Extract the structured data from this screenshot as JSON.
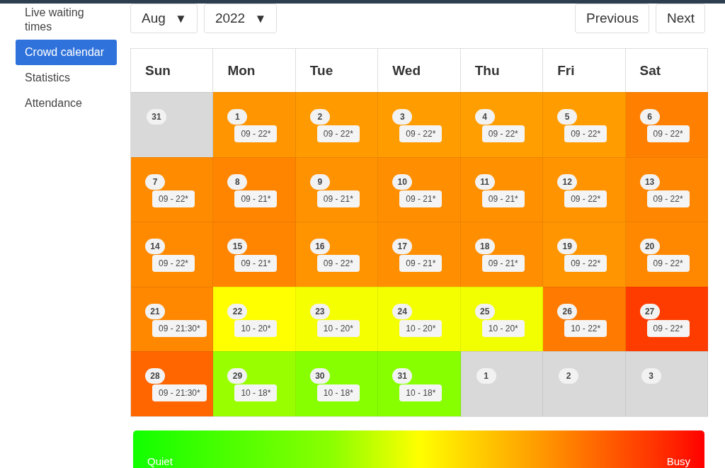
{
  "sidebar": {
    "items": [
      {
        "label": "Live waiting times",
        "selected": false
      },
      {
        "label": "Crowd calendar",
        "selected": true
      },
      {
        "label": "Statistics",
        "selected": false
      },
      {
        "label": "Attendance",
        "selected": false
      }
    ]
  },
  "controls": {
    "month": {
      "value": "Aug",
      "caret": "▼"
    },
    "year": {
      "value": "2022",
      "caret": "▼"
    },
    "buttons": [
      "Previous",
      "Next"
    ]
  },
  "calendar": {
    "weekdays": [
      "Sun",
      "Mon",
      "Tue",
      "Wed",
      "Thu",
      "Fri",
      "Sat"
    ],
    "weeks": [
      [
        {
          "day": "31",
          "kind": "other",
          "color": "#d9d9d9"
        },
        {
          "day": "1",
          "hours": "09 - 22*",
          "kind": "month",
          "color": "#ff9500"
        },
        {
          "day": "2",
          "hours": "09 - 22*",
          "kind": "month",
          "color": "#ff9a00"
        },
        {
          "day": "3",
          "hours": "09 - 22*",
          "kind": "month",
          "color": "#ff9c00"
        },
        {
          "day": "4",
          "hours": "09 - 22*",
          "kind": "month",
          "color": "#ff9e00"
        },
        {
          "day": "5",
          "hours": "09 - 22*",
          "kind": "month",
          "color": "#ff9d00"
        },
        {
          "day": "6",
          "hours": "09 - 22*",
          "kind": "month",
          "color": "#ff8000"
        }
      ],
      [
        {
          "day": "7",
          "hours": "09 - 22*",
          "kind": "month",
          "color": "#ff8c00"
        },
        {
          "day": "8",
          "hours": "09 - 21*",
          "kind": "month",
          "color": "#ff8500"
        },
        {
          "day": "9",
          "hours": "09 - 21*",
          "kind": "month",
          "color": "#ff9200"
        },
        {
          "day": "10",
          "hours": "09 - 21*",
          "kind": "month",
          "color": "#ff8e00"
        },
        {
          "day": "11",
          "hours": "09 - 21*",
          "kind": "month",
          "color": "#ff9000"
        },
        {
          "day": "12",
          "hours": "09 - 22*",
          "kind": "month",
          "color": "#ff9400"
        },
        {
          "day": "13",
          "hours": "09 - 22*",
          "kind": "month",
          "color": "#ff8600"
        }
      ],
      [
        {
          "day": "14",
          "hours": "09 - 22*",
          "kind": "month",
          "color": "#ff8a00"
        },
        {
          "day": "15",
          "hours": "09 - 21*",
          "kind": "month",
          "color": "#ff8400"
        },
        {
          "day": "16",
          "hours": "09 - 22*",
          "kind": "month",
          "color": "#ff9300"
        },
        {
          "day": "17",
          "hours": "09 - 21*",
          "kind": "month",
          "color": "#ff8f00"
        },
        {
          "day": "18",
          "hours": "09 - 21*",
          "kind": "month",
          "color": "#ff8e00"
        },
        {
          "day": "19",
          "hours": "09 - 22*",
          "kind": "month",
          "color": "#ff9500"
        },
        {
          "day": "20",
          "hours": "09 - 22*",
          "kind": "month",
          "color": "#ff8800"
        }
      ],
      [
        {
          "day": "21",
          "hours": "09 - 21:30*",
          "kind": "month",
          "color": "#ff8800"
        },
        {
          "day": "22",
          "hours": "10 - 20*",
          "kind": "month",
          "color": "#ffff00"
        },
        {
          "day": "23",
          "hours": "10 - 20*",
          "kind": "month",
          "color": "#f5ff00"
        },
        {
          "day": "24",
          "hours": "10 - 20*",
          "kind": "month",
          "color": "#f4ff00"
        },
        {
          "day": "25",
          "hours": "10 - 20*",
          "kind": "month",
          "color": "#f2ff00"
        },
        {
          "day": "26",
          "hours": "10 - 22*",
          "kind": "month",
          "color": "#ff7a00"
        },
        {
          "day": "27",
          "hours": "09 - 22*",
          "kind": "month",
          "color": "#ff3c00"
        }
      ],
      [
        {
          "day": "28",
          "hours": "09 - 21:30*",
          "kind": "month",
          "color": "#ff6600"
        },
        {
          "day": "29",
          "hours": "10 - 18*",
          "kind": "month",
          "color": "#99ff00"
        },
        {
          "day": "30",
          "hours": "10 - 18*",
          "kind": "month",
          "color": "#88ff00"
        },
        {
          "day": "31",
          "hours": "10 - 18*",
          "kind": "month",
          "color": "#88ff00"
        },
        {
          "day": "1",
          "kind": "other",
          "color": "#d9d9d9"
        },
        {
          "day": "2",
          "kind": "other",
          "color": "#d9d9d9"
        },
        {
          "day": "3",
          "kind": "other",
          "color": "#d9d9d9"
        }
      ]
    ]
  },
  "legend": {
    "low": "Quiet",
    "high": "Busy"
  }
}
